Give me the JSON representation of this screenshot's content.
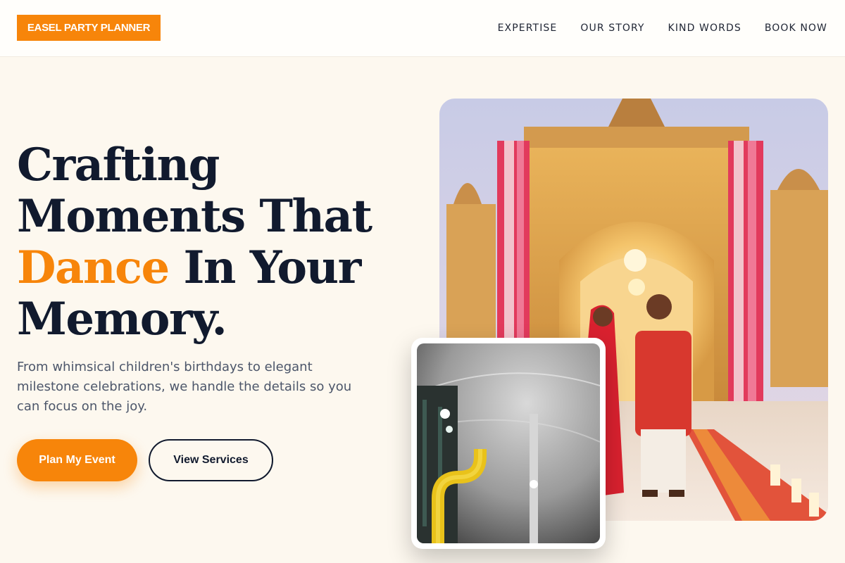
{
  "brand": {
    "logo_text": "EASEL PARTY PLANNER",
    "accent_color": "#f7850a",
    "ink_color": "#111a2e",
    "background_color": "#fdf8ef"
  },
  "nav": {
    "items": [
      {
        "label": "EXPERTISE"
      },
      {
        "label": "OUR STORY"
      },
      {
        "label": "KIND WORDS"
      },
      {
        "label": "BOOK NOW"
      }
    ]
  },
  "hero": {
    "title_line1": "Crafting",
    "title_line2": "Moments That",
    "title_accent": "Dance",
    "title_line3_rest": " In Your",
    "title_line4": "Memory.",
    "subtitle": "From whimsical children's birthdays to elegant milestone celebrations, we handle the details so you can focus on the joy.",
    "primary_button": "Plan My Event",
    "secondary_button": "View Services"
  },
  "images": {
    "main": "wedding-couple-ornate-palace-arch-photo",
    "inset": "event-tent-interior-yellow-pipe-photo"
  }
}
